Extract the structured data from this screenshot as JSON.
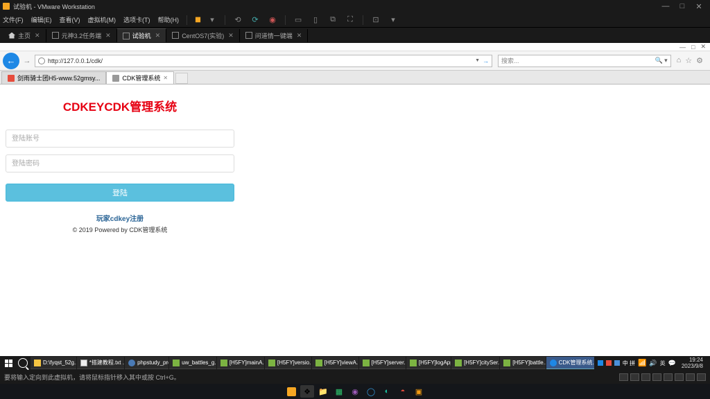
{
  "vmware": {
    "title": "试验机 - VMware Workstation",
    "menu": [
      "文件(F)",
      "编辑(E)",
      "查看(V)",
      "虚拟机(M)",
      "选项卡(T)",
      "帮助(H)"
    ],
    "tabs": [
      {
        "label": "主页",
        "active": false,
        "home": true
      },
      {
        "label": "元神3.2任务端",
        "active": false
      },
      {
        "label": "试验机",
        "active": true
      },
      {
        "label": "CentOS7(实验)",
        "active": false
      },
      {
        "label": "问道情一键端",
        "active": false
      }
    ],
    "status": "要将输入定向到此虚拟机，请将鼠标指针移入其中或按 Ctrl+G。"
  },
  "ie": {
    "url": "http://127.0.0.1/cdk/",
    "search_placeholder": "搜索...",
    "refresh_glyph": "→",
    "tabs": [
      {
        "label": "剑雨骑士团H5-www.52gmsy...",
        "active": false
      },
      {
        "label": "CDK管理系统",
        "active": true
      }
    ],
    "win_min": "—",
    "win_box": "□",
    "win_x": "✕"
  },
  "login_page": {
    "title": "CDKEYCDK管理系统",
    "user_placeholder": "登陆账号",
    "pass_placeholder": "登陆密码",
    "submit": "登陆",
    "register_link": "玩家cdkey注册",
    "copyright": "© 2019 Powered by CDK管理系统"
  },
  "guest_taskbar": {
    "items": [
      {
        "label": "D:\\fyqst_52g...",
        "cls": "folder"
      },
      {
        "label": "*搭建教程.txt ...",
        "cls": "txt"
      },
      {
        "label": "phpstudy_pro",
        "cls": "php"
      },
      {
        "label": "uw_battles_g...",
        "cls": "np"
      },
      {
        "label": "[H5FY]mainA...",
        "cls": "np"
      },
      {
        "label": "[H5FY]versio...",
        "cls": "np"
      },
      {
        "label": "[H5FY]viewA...",
        "cls": "np"
      },
      {
        "label": "[H5FY]server...",
        "cls": "np"
      },
      {
        "label": "[H5FY]logApp",
        "cls": "np"
      },
      {
        "label": "[H5FY]citySer...",
        "cls": "np"
      },
      {
        "label": "[H5FY]battle...",
        "cls": "np"
      },
      {
        "label": "CDK管理系统...",
        "cls": "ie",
        "active": true
      }
    ],
    "tray_lang": "中 拼",
    "tray_ime": "英",
    "time": "19:24",
    "date": "2023/9/8"
  }
}
